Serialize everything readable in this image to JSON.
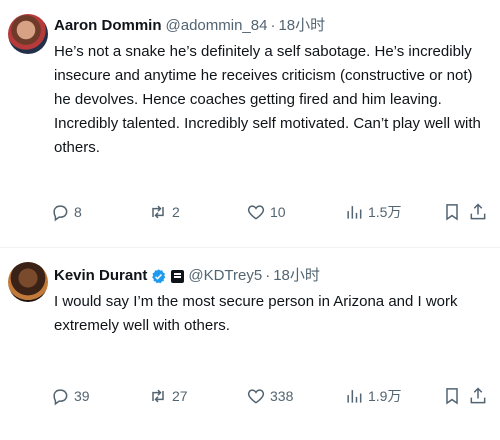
{
  "tweets": [
    {
      "name": "Aaron Dommin",
      "handle": "@adommin_84",
      "separator": "·",
      "time": "18小时",
      "text": "He’s not a snake he’s definitely a self sabotage. He’s incredibly insecure and anytime he receives criticism (constructive or not) he devolves. Hence coaches getting fired and him leaving. Incredibly talented. Incredibly self motivated. Can’t play well with others.",
      "replies": "8",
      "retweets": "2",
      "likes": "10",
      "views": "1.5万"
    },
    {
      "name": "Kevin Durant",
      "handle": "@KDTrey5",
      "separator": "·",
      "time": "18小时",
      "text": "I would say I’m the most secure person in Arizona and I work extremely well with others.",
      "replies": "39",
      "retweets": "27",
      "likes": "338",
      "views": "1.9万"
    }
  ],
  "colors": {
    "text": "#0f1419",
    "secondary": "#536471",
    "verified": "#1d9bf0",
    "divider": "#eff3f4"
  },
  "icons": [
    "reply-icon",
    "retweet-icon",
    "like-icon",
    "views-icon",
    "bookmark-icon",
    "share-icon",
    "verified-icon",
    "affiliate-icon"
  ]
}
